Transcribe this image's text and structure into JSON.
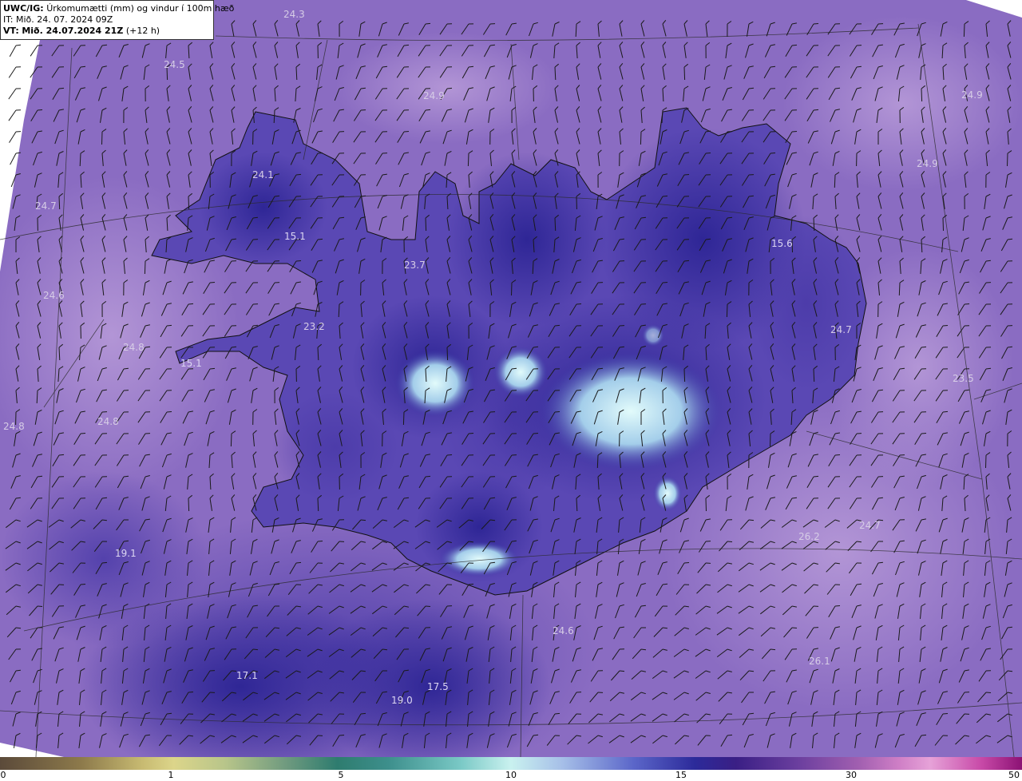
{
  "header": {
    "product_code": "UWC/IG:",
    "title": "Úrkomumætti (mm) og vindur í 100m hæð",
    "it_line": "IT: Mið. 24. 07. 2024 09Z",
    "vt_label": "VT:",
    "vt_value": "Mið. 24.07.2024 21Z",
    "vt_suffix": "(+12 h)"
  },
  "map_values": [
    {
      "text": "24.3",
      "dark": false
    },
    {
      "text": "24.5",
      "dark": false
    },
    {
      "text": "24.9",
      "dark": false
    },
    {
      "text": "24.9",
      "dark": false
    },
    {
      "text": "24.9",
      "dark": false
    },
    {
      "text": "24.1",
      "dark": false
    },
    {
      "text": "24.7",
      "dark": false
    },
    {
      "text": "15.1",
      "dark": true
    },
    {
      "text": "23.7",
      "dark": false
    },
    {
      "text": "15.6",
      "dark": true
    },
    {
      "text": "24.6",
      "dark": false
    },
    {
      "text": "23.2",
      "dark": false
    },
    {
      "text": "24.8",
      "dark": false
    },
    {
      "text": "15.1",
      "dark": true
    },
    {
      "text": "24.7",
      "dark": false
    },
    {
      "text": "23.5",
      "dark": false
    },
    {
      "text": "24.8",
      "dark": false
    },
    {
      "text": "24.8",
      "dark": false
    },
    {
      "text": "26.2",
      "dark": false
    },
    {
      "text": "24.7",
      "dark": false
    },
    {
      "text": "19.1",
      "dark": true
    },
    {
      "text": "24.6",
      "dark": false
    },
    {
      "text": "26.1",
      "dark": false
    },
    {
      "text": "17.1",
      "dark": true
    },
    {
      "text": "17.5",
      "dark": true
    },
    {
      "text": "19.0",
      "dark": true
    }
  ],
  "colorbar": {
    "ticks": [
      "0",
      "1",
      "5",
      "10",
      "15",
      "30",
      "50"
    ]
  },
  "colors": {
    "sea_base": "#8a6cc2",
    "light_purple": "#a989cf",
    "deep_blue": "#2f2796",
    "maximum": "#d4f4f4"
  }
}
